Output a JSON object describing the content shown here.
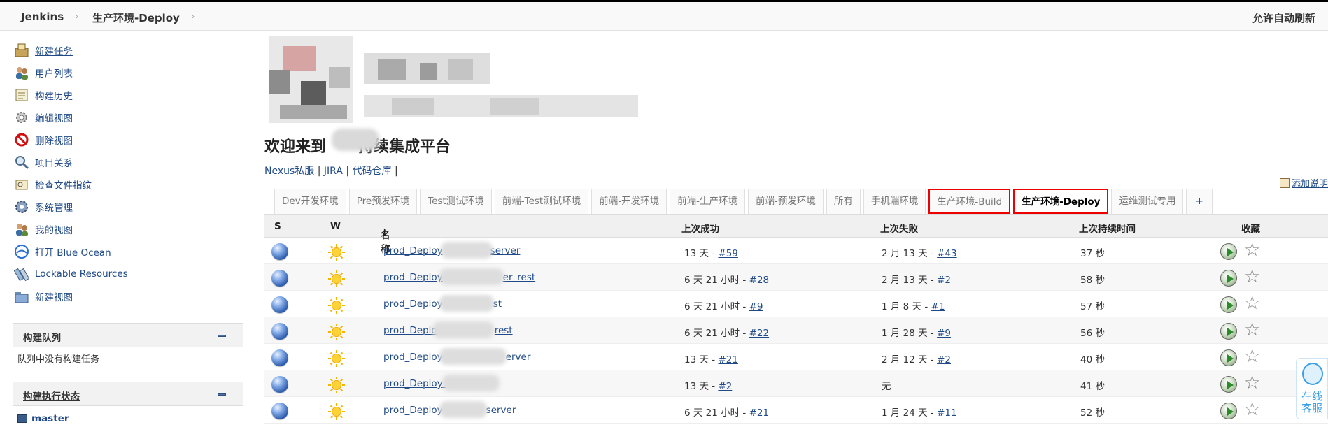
{
  "header": {
    "breadcrumb": [
      "Jenkins",
      "生产环境-Deploy"
    ],
    "auto_refresh": "允许自动刷新"
  },
  "sidebar": {
    "tasks": [
      {
        "label": "新建任务",
        "icon": "new-item-icon"
      },
      {
        "label": "用户列表",
        "icon": "users-icon"
      },
      {
        "label": "构建历史",
        "icon": "build-history-icon"
      },
      {
        "label": "编辑视图",
        "icon": "edit-view-icon"
      },
      {
        "label": "删除视图",
        "icon": "delete-view-icon"
      },
      {
        "label": "项目关系",
        "icon": "project-relation-icon"
      },
      {
        "label": "检查文件指纹",
        "icon": "fingerprint-icon"
      },
      {
        "label": "系统管理",
        "icon": "gear-icon"
      },
      {
        "label": "我的视图",
        "icon": "my-views-icon"
      },
      {
        "label": "打开 Blue Ocean",
        "icon": "blue-ocean-icon"
      },
      {
        "label": "Lockable Resources",
        "icon": "lockable-resources-icon"
      },
      {
        "label": "新建视图",
        "icon": "folder-icon"
      }
    ],
    "build_queue": {
      "title": "构建队列",
      "empty_text": "队列中没有构建任务"
    },
    "executor_status": {
      "title": "构建执行状态",
      "node": "master"
    }
  },
  "main": {
    "welcome": "欢迎来到 持续集成平台",
    "welcome_part1": "欢迎来到",
    "welcome_part2": "持续集成平台",
    "links": [
      {
        "label": "Nexus私服"
      },
      {
        "label": "JIRA"
      },
      {
        "label": "代码仓库"
      }
    ],
    "link_separator": "|",
    "add_description": "添加说明",
    "tabs": [
      {
        "label": "Dev开发环境"
      },
      {
        "label": "Pre预发环境"
      },
      {
        "label": "Test测试环境"
      },
      {
        "label": "前端-Test测试环境"
      },
      {
        "label": "前端-开发环境"
      },
      {
        "label": "前端-生产环境"
      },
      {
        "label": "前端-预发环境"
      },
      {
        "label": "所有"
      },
      {
        "label": "手机端环境"
      },
      {
        "label": "生产环境-Build"
      },
      {
        "label": "生产环境-Deploy"
      },
      {
        "label": "运维测试专用"
      },
      {
        "label": "+"
      }
    ],
    "table": {
      "columns": {
        "s": "S",
        "w": "W",
        "name": "名称",
        "sort_arrow": "↓",
        "last_success": "上次成功",
        "last_failure": "上次失败",
        "last_duration": "上次持续时间",
        "favorite": "收藏"
      },
      "rows": [
        {
          "name_start": "prod_Deploy",
          "name_end": "server",
          "success_time": "13 天 - ",
          "success_build": "#59",
          "failure_time": "2 月 13 天 - ",
          "failure_build": "#43",
          "duration": "37 秒"
        },
        {
          "name_start": "prod_Deploy",
          "name_end": "er_rest",
          "success_time": "6 天 21 小时 - ",
          "success_build": "#28",
          "failure_time": "2 月 13 天 - ",
          "failure_build": "#2",
          "duration": "58 秒"
        },
        {
          "name_start": "prod_Deploy",
          "name_end": "st",
          "success_time": "6 天 21 小时 - ",
          "success_build": "#9",
          "failure_time": "1 月 8 天 - ",
          "failure_build": "#1",
          "duration": "57 秒"
        },
        {
          "name_start": "prod_Deplo",
          "name_end": "rest",
          "success_time": "6 天 21 小时 - ",
          "success_build": "#22",
          "failure_time": "1 月 28 天 - ",
          "failure_build": "#9",
          "duration": "56 秒"
        },
        {
          "name_start": "prod_Deploy",
          "name_end": "erver",
          "success_time": "13 天 - ",
          "success_build": "#21",
          "failure_time": "2 月 12 天 - ",
          "failure_build": "#2",
          "duration": "40 秒"
        },
        {
          "name_start": "prod_Deploy-",
          "name_end": "",
          "success_time": "13 天 - ",
          "success_build": "#2",
          "failure_time": "无",
          "failure_build": "",
          "duration": "41 秒"
        },
        {
          "name_start": "prod_Deploy",
          "name_end": "server",
          "success_time": "6 天 21 小时 - ",
          "success_build": "#21",
          "failure_time": "1 月 24 天 - ",
          "failure_build": "#11",
          "duration": "52 秒"
        }
      ]
    }
  },
  "float_service": {
    "line1": "在线",
    "line2": "客服"
  }
}
